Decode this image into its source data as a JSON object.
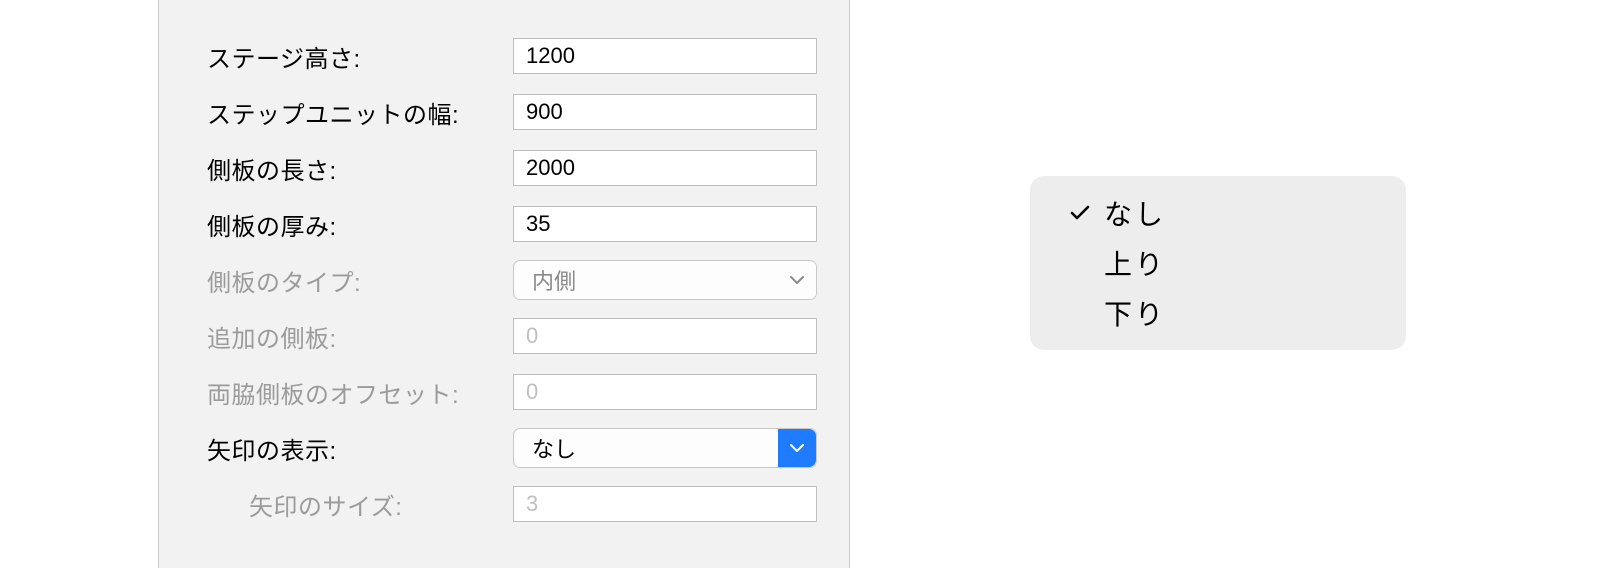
{
  "form": {
    "stage_height": {
      "label": "ステージ高さ:",
      "value": "1200",
      "disabled": false
    },
    "step_unit_width": {
      "label": "ステップユニットの幅:",
      "value": "900",
      "disabled": false
    },
    "side_length": {
      "label": "側板の長さ:",
      "value": "2000",
      "disabled": false
    },
    "side_thickness": {
      "label": "側板の厚み:",
      "value": "35",
      "disabled": false
    },
    "side_type": {
      "label": "側板のタイプ:",
      "value": "内側",
      "disabled": true
    },
    "extra_side": {
      "label": "追加の側板:",
      "value": "0",
      "disabled": true
    },
    "side_offset": {
      "label": "両脇側板のオフセット:",
      "value": "0",
      "disabled": true
    },
    "arrow_display": {
      "label": "矢印の表示:",
      "value": "なし",
      "disabled": false
    },
    "arrow_size": {
      "label": "矢印のサイズ:",
      "value": "3",
      "disabled": true
    }
  },
  "arrow_menu": {
    "items": [
      {
        "label": "なし",
        "checked": true
      },
      {
        "label": "上り",
        "checked": false
      },
      {
        "label": "下り",
        "checked": false
      }
    ]
  }
}
